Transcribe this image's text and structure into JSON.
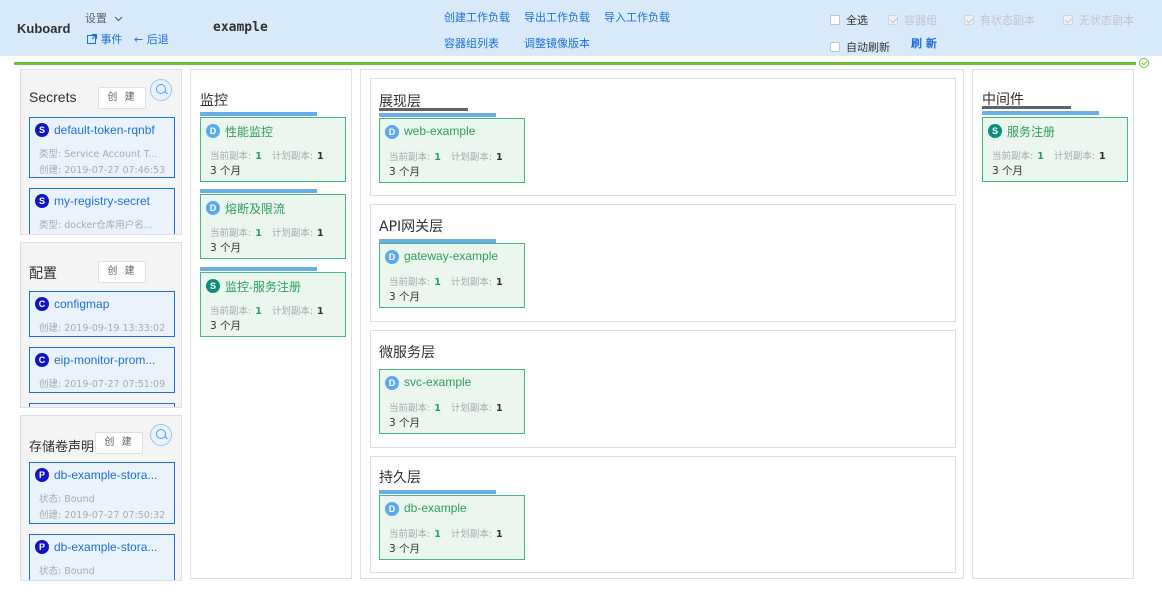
{
  "topbar": {
    "brand": "Kuboard",
    "settings_label": "设置",
    "events_label": "事件",
    "back_label": "后退",
    "namespace": "example",
    "actions": {
      "create_workload": "创建工作负载",
      "export_workload": "导出工作负载",
      "import_workload": "导入工作负载",
      "pod_list": "容器组列表",
      "adjust_image": "调整镜像版本"
    },
    "filters": {
      "select_all": "全选",
      "pods": "容器组",
      "stateful": "有状态副本",
      "stateless": "无状态副本",
      "auto_refresh": "自动刷新",
      "refresh": "刷 新"
    }
  },
  "left": {
    "secrets": {
      "title": "Secrets",
      "create": "创 建",
      "items": [
        {
          "badge": "S",
          "name": "default-token-rqnbf",
          "line1": "类型:  Service Account T...",
          "line2": "创建:  2019-07-27 07:46:53"
        },
        {
          "badge": "S",
          "name": "my-registry-secret",
          "line1": "类型:  docker仓库用户名...",
          "line2": ""
        }
      ]
    },
    "configmaps": {
      "title": "配置",
      "create": "创 建",
      "items": [
        {
          "badge": "C",
          "name": "configmap",
          "line1": "创建:  2019-09-19 13:33:02"
        },
        {
          "badge": "C",
          "name": "eip-monitor-prom...",
          "line1": "创建:  2019-07-27 07:51:09"
        }
      ]
    },
    "pvcs": {
      "title": "存储卷声明",
      "create": "创 建",
      "items": [
        {
          "badge": "P",
          "name": "db-example-stora...",
          "line1": "状态:  Bound",
          "line2": "创建:  2019-07-27 07:50:32"
        },
        {
          "badge": "P",
          "name": "db-example-stora...",
          "line1": "状态:  Bound",
          "line2": ""
        }
      ]
    }
  },
  "labels": {
    "current_replicas": "当前副本:",
    "planned_replicas": "计划副本:"
  },
  "monitor": {
    "title": "监控",
    "workloads": [
      {
        "badge": "D",
        "name": "性能监控",
        "current": "1",
        "planned": "1",
        "age": "3  个月"
      },
      {
        "badge": "D",
        "name": "熔断及限流",
        "current": "1",
        "planned": "1",
        "age": "3  个月"
      },
      {
        "badge": "S",
        "name": "监控-服务注册",
        "current": "1",
        "planned": "1",
        "age": "3  个月"
      }
    ]
  },
  "layers": [
    {
      "title": "展现层",
      "workload": {
        "badge": "D",
        "name": "web-example",
        "current": "1",
        "planned": "1",
        "age": "3  个月"
      }
    },
    {
      "title": "API网关层",
      "workload": {
        "badge": "D",
        "name": "gateway-example",
        "current": "1",
        "planned": "1",
        "age": "3  个月"
      }
    },
    {
      "title": "微服务层",
      "workload": {
        "badge": "D",
        "name": "svc-example",
        "current": "1",
        "planned": "1",
        "age": "3  个月"
      }
    },
    {
      "title": "持久层",
      "workload": {
        "badge": "D",
        "name": "db-example",
        "current": "1",
        "planned": "1",
        "age": "3  个月"
      }
    }
  ],
  "middleware": {
    "title": "中间件",
    "workload": {
      "badge": "S",
      "name": "服务注册",
      "current": "1",
      "planned": "1",
      "age": "3  个月"
    }
  },
  "colors": {
    "topbar_bg": "#d9ebfb",
    "link_blue": "#1e6fd6",
    "workload_green": "#42b883",
    "status_bar": "#67c23a"
  }
}
